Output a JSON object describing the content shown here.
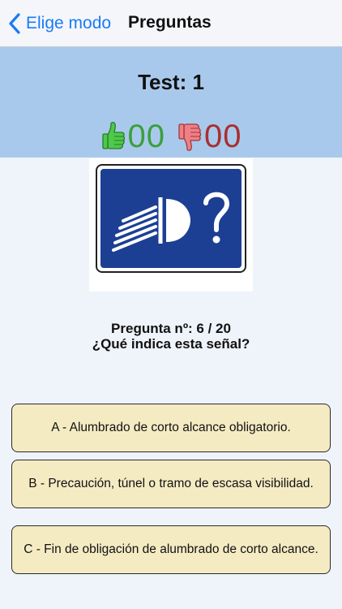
{
  "nav": {
    "back_label": "Elige modo",
    "title": "Preguntas"
  },
  "test": {
    "title": "Test: 1",
    "correct_count": "00",
    "wrong_count": "00"
  },
  "sign": {
    "description": "road-sign-headlight-question"
  },
  "question": {
    "number_line": "Pregunta nº: 6 / 20",
    "text": "¿Qué indica esta señal?"
  },
  "answers": [
    {
      "label": "A - Alumbrado de corto alcance obligatorio."
    },
    {
      "label": "B - Precaución, túnel o tramo de escasa visibilidad."
    },
    {
      "label": "C - Fin de obligación de alumbrado de corto alcance."
    }
  ],
  "colors": {
    "accent": "#1a7bf5",
    "header_band": "#a9c9ec",
    "answer_bg": "#f5ebc3",
    "correct": "#3aa03a",
    "wrong": "#a83030",
    "sign_blue": "#1c3f94"
  }
}
